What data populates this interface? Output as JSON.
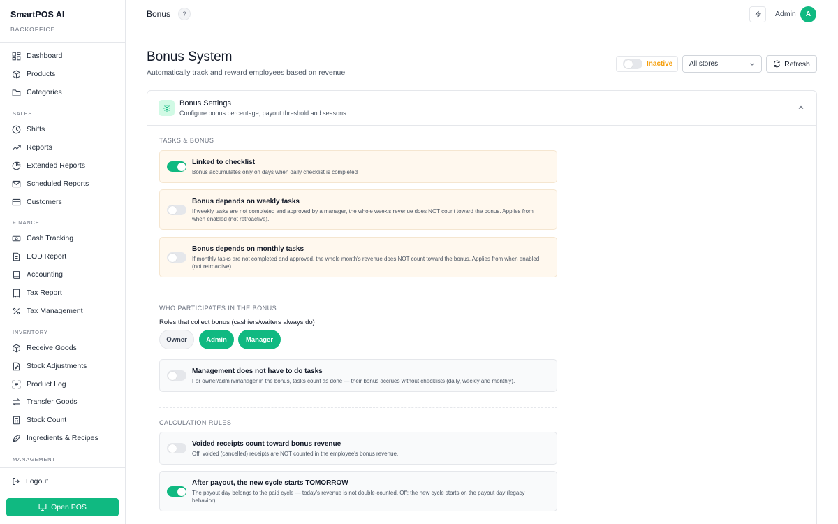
{
  "app": {
    "name": "SmartPOS AI",
    "subtitle": "BACKOFFICE"
  },
  "sidebar": {
    "top_items": [
      {
        "label": "Dashboard",
        "icon": "grid-icon"
      },
      {
        "label": "Products",
        "icon": "box-icon"
      },
      {
        "label": "Categories",
        "icon": "folder-icon"
      }
    ],
    "sections": {
      "sales": "SALES",
      "finance": "FINANCE",
      "inventory": "INVENTORY",
      "management": "MANAGEMENT"
    },
    "sales_items": [
      {
        "label": "Shifts"
      },
      {
        "label": "Reports"
      },
      {
        "label": "Extended Reports"
      },
      {
        "label": "Scheduled Reports"
      },
      {
        "label": "Customers"
      }
    ],
    "finance_items": [
      {
        "label": "Cash Tracking"
      },
      {
        "label": "EOD Report"
      },
      {
        "label": "Accounting"
      },
      {
        "label": "Tax Report"
      },
      {
        "label": "Tax Management"
      }
    ],
    "inventory_items": [
      {
        "label": "Receive Goods"
      },
      {
        "label": "Stock Adjustments"
      },
      {
        "label": "Product Log"
      },
      {
        "label": "Transfer Goods"
      },
      {
        "label": "Stock Count"
      },
      {
        "label": "Ingredients & Recipes"
      }
    ],
    "logout": "Logout",
    "open_pos": "Open POS"
  },
  "topbar": {
    "title": "Bonus",
    "user": "Admin",
    "avatar": "A"
  },
  "header": {
    "title": "Bonus System",
    "subtitle": "Automatically track and reward employees based on revenue",
    "status": "Inactive",
    "store": "All stores",
    "refresh": "Refresh"
  },
  "settings": {
    "title": "Bonus Settings",
    "subtitle": "Configure bonus percentage, payout threshold and seasons",
    "tasks_heading": "TASKS & BONUS",
    "participants_heading": "WHO PARTICIPATES IN THE BONUS",
    "roles_label": "Roles that collect bonus (cashiers/waiters always do)",
    "roles": [
      {
        "label": "Owner",
        "selected": false
      },
      {
        "label": "Admin",
        "selected": true
      },
      {
        "label": "Manager",
        "selected": true
      }
    ],
    "calc_heading": "CALCULATION RULES",
    "options": {
      "linked": {
        "title": "Linked to checklist",
        "desc": "Bonus accumulates only on days when daily checklist is completed",
        "enabled": true
      },
      "weekly": {
        "title": "Bonus depends on weekly tasks",
        "desc": "If weekly tasks are not completed and approved by a manager, the whole week's revenue does NOT count toward the bonus. Applies from when enabled (not retroactive).",
        "enabled": false
      },
      "monthly": {
        "title": "Bonus depends on monthly tasks",
        "desc": "If monthly tasks are not completed and approved, the whole month's revenue does NOT count toward the bonus. Applies from when enabled (not retroactive).",
        "enabled": false
      },
      "mgmt": {
        "title": "Management does not have to do tasks",
        "desc": "For owner/admin/manager in the bonus, tasks count as done — their bonus accrues without checklists (daily, weekly and monthly).",
        "enabled": false
      },
      "voided": {
        "title": "Voided receipts count toward bonus revenue",
        "desc": "Off: voided (cancelled) receipts are NOT counted in the employee's bonus revenue.",
        "enabled": false
      },
      "payout": {
        "title": "After payout, the new cycle starts TOMORROW",
        "desc": "The payout day belongs to the paid cycle — today's revenue is not double-counted. Off: the new cycle starts on the payout day (legacy behavior).",
        "enabled": true
      }
    }
  },
  "colors": {
    "accent": "#10b981",
    "warning": "#f59e0b"
  }
}
